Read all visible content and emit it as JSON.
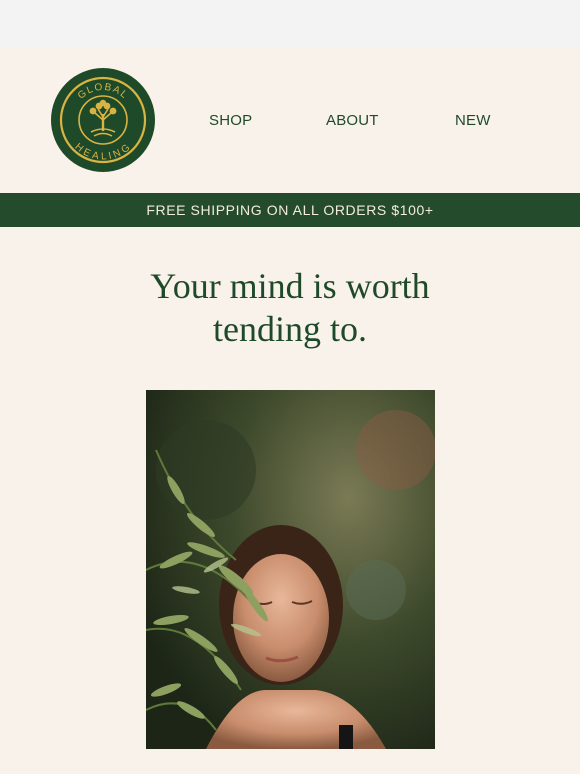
{
  "brand": {
    "logo_text_top": "GLOBAL",
    "logo_text_bottom": "HEALING",
    "colors": {
      "primary": "#1f4a2a",
      "gold": "#d9b343",
      "background": "#f9f2ea"
    }
  },
  "nav": {
    "items": [
      {
        "label": "SHOP"
      },
      {
        "label": "ABOUT"
      },
      {
        "label": "NEW"
      }
    ]
  },
  "banner": {
    "text": "FREE SHIPPING ON ALL ORDERS $100+"
  },
  "hero": {
    "headline_line1": "Your mind is worth",
    "headline_line2": "tending to.",
    "image_icon": "woman-with-leaves-photo"
  }
}
